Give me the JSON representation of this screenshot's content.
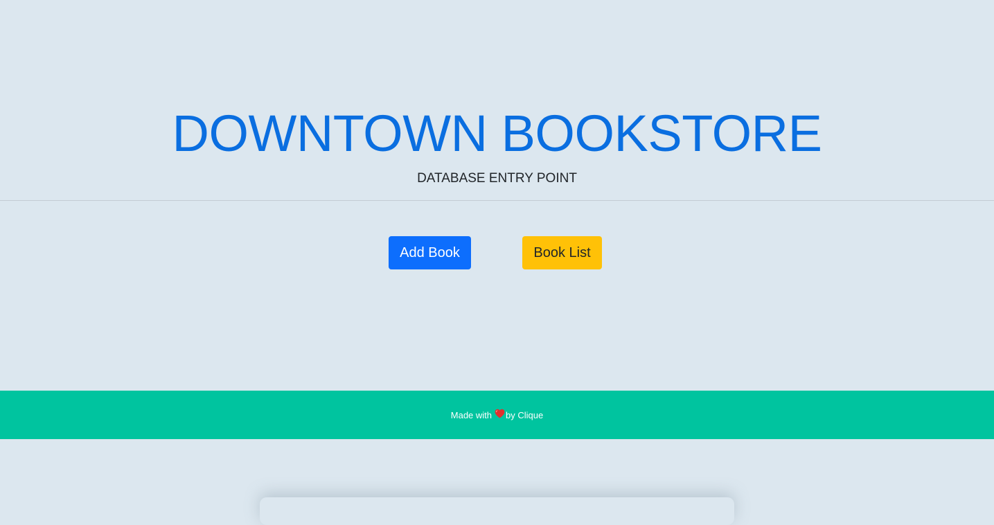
{
  "hero": {
    "title": "DOWNTOWN BOOKSTORE",
    "subtitle": "DATABASE ENTRY POINT"
  },
  "actions": {
    "add_book_label": "Add Book",
    "book_list_label": "Book List"
  },
  "footer": {
    "text_before": "Made with",
    "icon": "heart-icon",
    "text_after": "by Clique"
  },
  "colors": {
    "background": "#dce7ef",
    "title": "#0a6ee0",
    "primary_button": "#0d6efd",
    "warning_button": "#ffc107",
    "footer": "#00c49f",
    "heart": "#e0302e"
  }
}
